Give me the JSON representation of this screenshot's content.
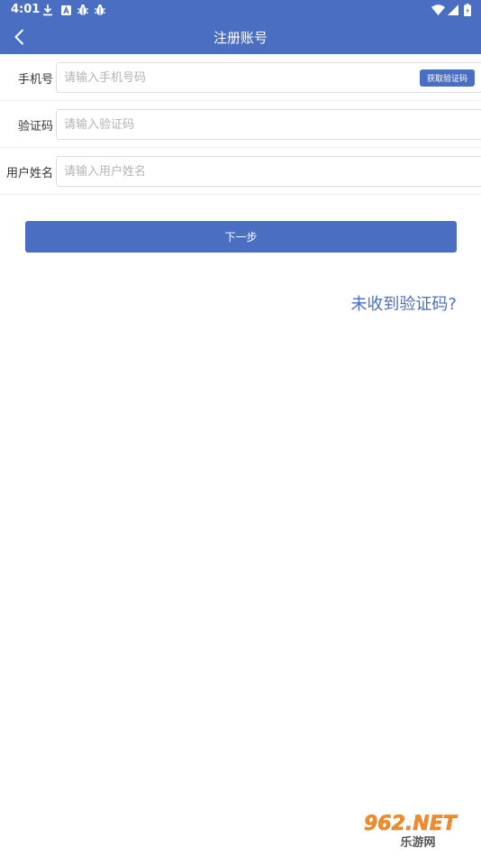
{
  "status_bar": {
    "time": "4:01",
    "icons": [
      "download-icon",
      "a-icon",
      "bug-icon",
      "bug-icon",
      "wifi-icon",
      "signal-icon",
      "battery-icon"
    ]
  },
  "nav": {
    "back_icon": "chevron-left-icon",
    "title": "注册账号"
  },
  "form": {
    "phone": {
      "label": "手机号",
      "placeholder": "请输入手机号码",
      "value": ""
    },
    "get_code_label": "获取验证码",
    "code": {
      "label": "验证码",
      "placeholder": "请输入验证码",
      "value": ""
    },
    "username": {
      "label": "用户姓名",
      "placeholder": "请输入用户姓名",
      "value": ""
    }
  },
  "next_button": "下一步",
  "no_code_link": "未收到验证码?",
  "watermark": {
    "top": "962.NET",
    "bottom": "乐游网"
  },
  "colors": {
    "primary": "#4a6fc2",
    "background": "#ffffff",
    "placeholder": "#b3b3b3",
    "label": "#333333"
  }
}
